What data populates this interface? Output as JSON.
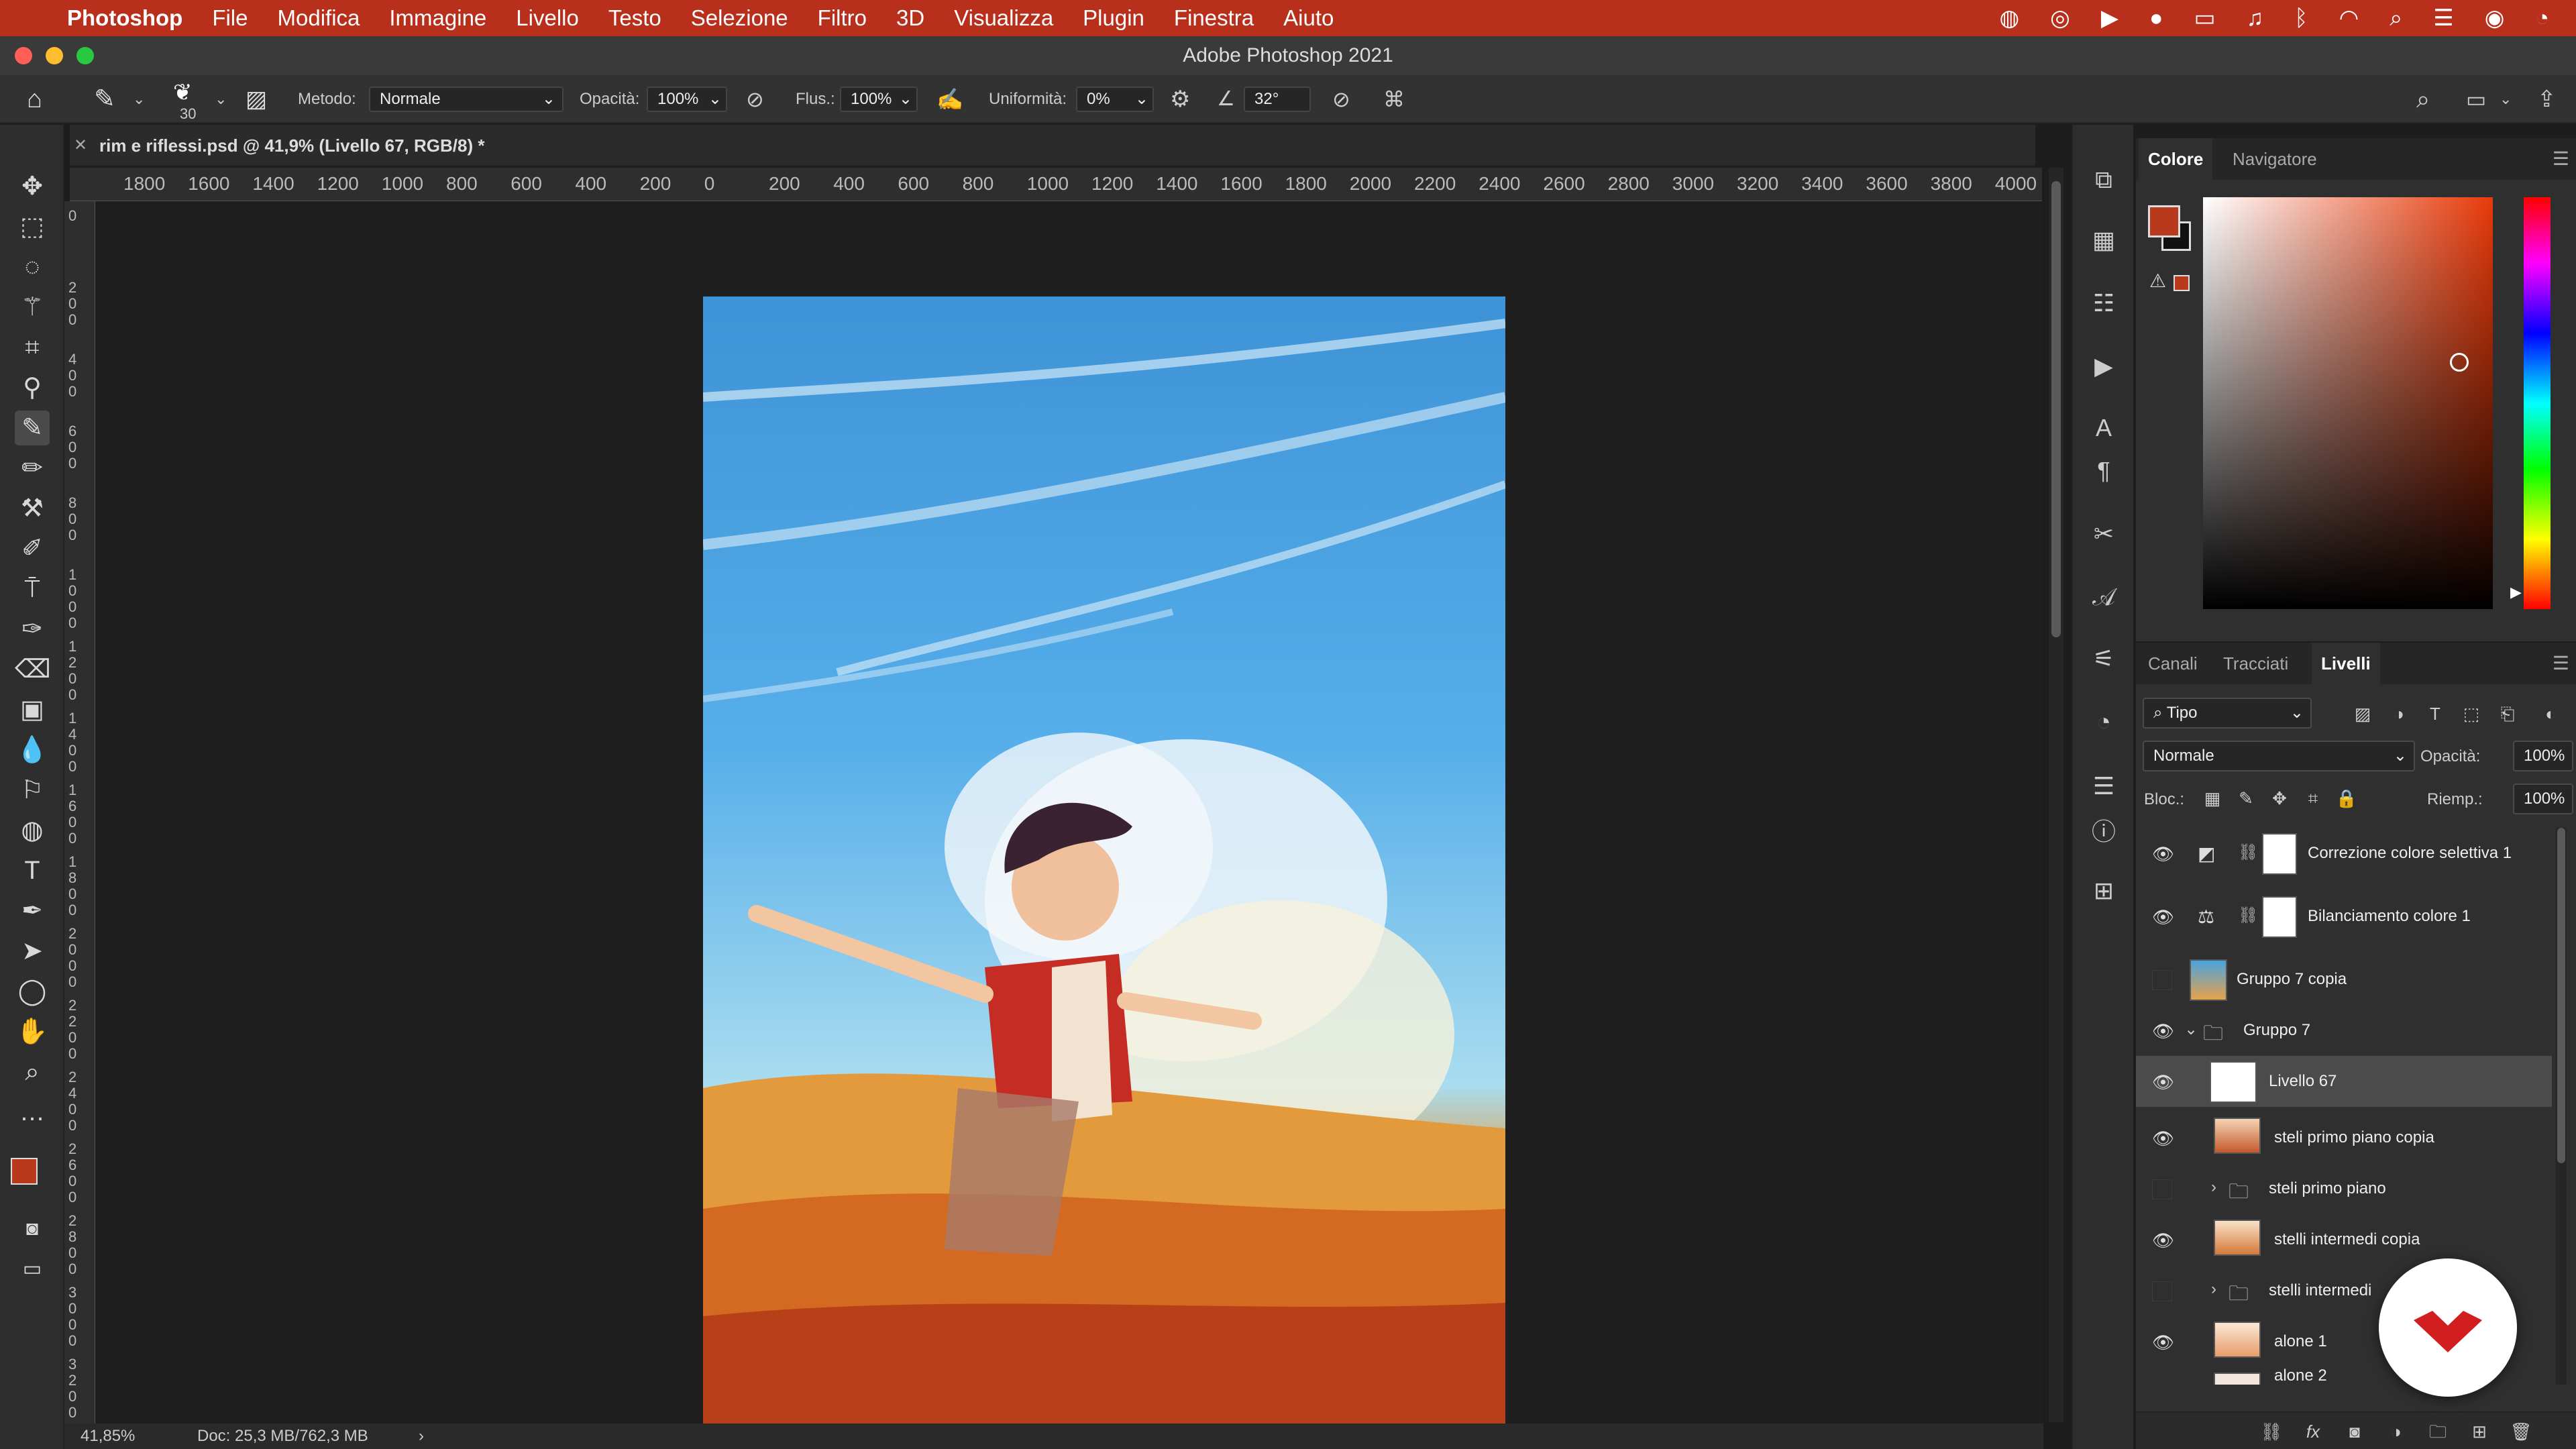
{
  "menubar": {
    "app": "Photoshop",
    "items": [
      "File",
      "Modifica",
      "Immagine",
      "Livello",
      "Testo",
      "Selezione",
      "Filtro",
      "3D",
      "Visualizza",
      "Plugin",
      "Finestra",
      "Aiuto"
    ]
  },
  "window": {
    "title": "Adobe Photoshop 2021"
  },
  "options": {
    "brush_size": "30",
    "mode_label": "Metodo:",
    "mode_value": "Normale",
    "opacity_label": "Opacità:",
    "opacity_value": "100%",
    "flow_label": "Flus.:",
    "flow_value": "100%",
    "smoothing_label": "Uniformità:",
    "smoothing_value": "0%",
    "angle_value": "32°"
  },
  "document": {
    "tab_title": "rim e riflessi.psd @ 41,9% (Livello 67, RGB/8) *",
    "ruler_h": [
      "1800",
      "1600",
      "1400",
      "1200",
      "1000",
      "800",
      "600",
      "400",
      "200",
      "0",
      "200",
      "400",
      "600",
      "800",
      "1000",
      "1200",
      "1400",
      "1600",
      "1800",
      "2000",
      "2200",
      "2400",
      "2600",
      "2800",
      "3000",
      "3200",
      "3400",
      "3600",
      "3800",
      "4000"
    ],
    "ruler_v": [
      "0",
      "200",
      "400",
      "600",
      "800",
      "1000",
      "1200",
      "1400",
      "1600",
      "1800",
      "2000",
      "2200",
      "2400",
      "2600",
      "2800",
      "3000",
      "3200"
    ]
  },
  "status": {
    "zoom": "41,85%",
    "doc": "Doc: 25,3 MB/762,3 MB"
  },
  "color_panel": {
    "tabs": [
      "Colore",
      "Navigatore"
    ],
    "fg_color": "#b8391c",
    "bg_color": "#111111"
  },
  "layers_panel": {
    "tabs": [
      "Canali",
      "Tracciati",
      "Livelli"
    ],
    "filter": "Tipo",
    "blend_mode": "Normale",
    "opacity_label": "Opacità:",
    "opacity_value": "100%",
    "lock_label": "Bloc.:",
    "fill_label": "Riemp.:",
    "fill_value": "100%",
    "layers": [
      {
        "name": "Correzione colore selettiva 1",
        "visible": true
      },
      {
        "name": "Bilanciamento colore 1",
        "visible": true
      },
      {
        "name": "Gruppo 7 copia",
        "visible": false
      },
      {
        "name": "Gruppo 7",
        "visible": true
      },
      {
        "name": "Livello 67",
        "visible": true
      },
      {
        "name": "steli primo piano copia",
        "visible": true
      },
      {
        "name": "steli primo piano",
        "visible": false
      },
      {
        "name": "stelli intermedi copia",
        "visible": true
      },
      {
        "name": "stelli intermedi",
        "visible": false
      },
      {
        "name": "alone 1",
        "visible": true
      },
      {
        "name": "alone 2",
        "visible": true
      }
    ]
  },
  "icons": [
    "apple-icon",
    "home-icon",
    "brush-icon",
    "move-tool-icon",
    "marquee-tool-icon",
    "lasso-tool-icon",
    "magic-wand-icon",
    "crop-tool-icon",
    "eyedropper-icon",
    "brush-tool-icon",
    "pencil-icon",
    "clone-stamp-icon",
    "eraser-icon",
    "gradient-icon",
    "blur-icon",
    "dodge-icon",
    "pen-icon",
    "text-tool-icon",
    "path-select-icon",
    "ellipse-icon",
    "hand-icon",
    "zoom-icon",
    "eye-icon",
    "folder-icon",
    "chain-icon",
    "search-icon",
    "share-icon",
    "trash-icon"
  ]
}
